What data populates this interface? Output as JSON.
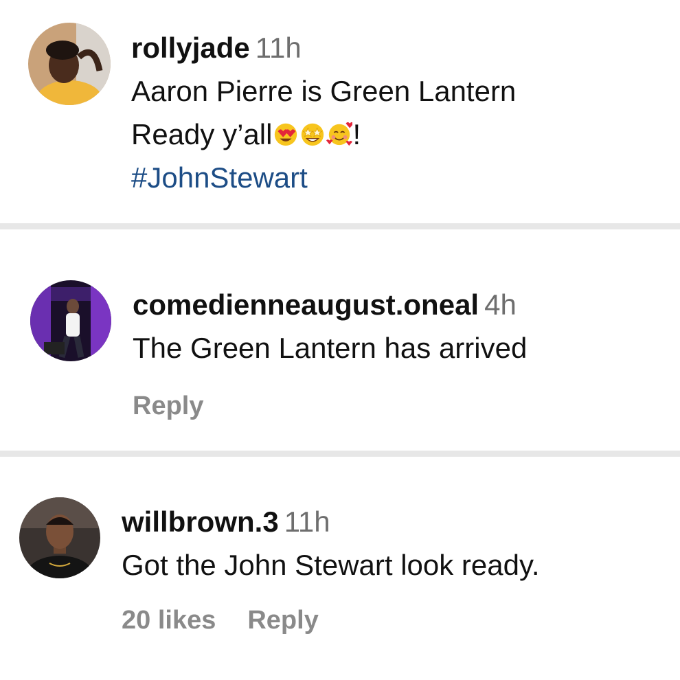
{
  "comments": [
    {
      "username": "rollyjade",
      "time": "11h",
      "text_line1": "Aaron Pierre is Green Lantern",
      "text_line2_prefix": "Ready y’all",
      "emojis": [
        "heart-eyes-emoji",
        "star-struck-emoji",
        "smiling-face-with-hearts-emoji"
      ],
      "text_line2_suffix": "!",
      "hashtag": "#JohnStewart"
    },
    {
      "username": "comedienneaugust.oneal",
      "time": "4h",
      "text": "The Green Lantern has arrived",
      "reply_label": "Reply"
    },
    {
      "username": "willbrown.3",
      "time": "11h",
      "text": "Got the John Stewart look ready.",
      "likes_label": "20 likes",
      "reply_label": "Reply"
    }
  ],
  "colors": {
    "text": "#111111",
    "muted": "#6e6e6e",
    "action": "#8a8a8a",
    "hashtag": "#1d4d86",
    "divider": "#e7e7e7"
  }
}
